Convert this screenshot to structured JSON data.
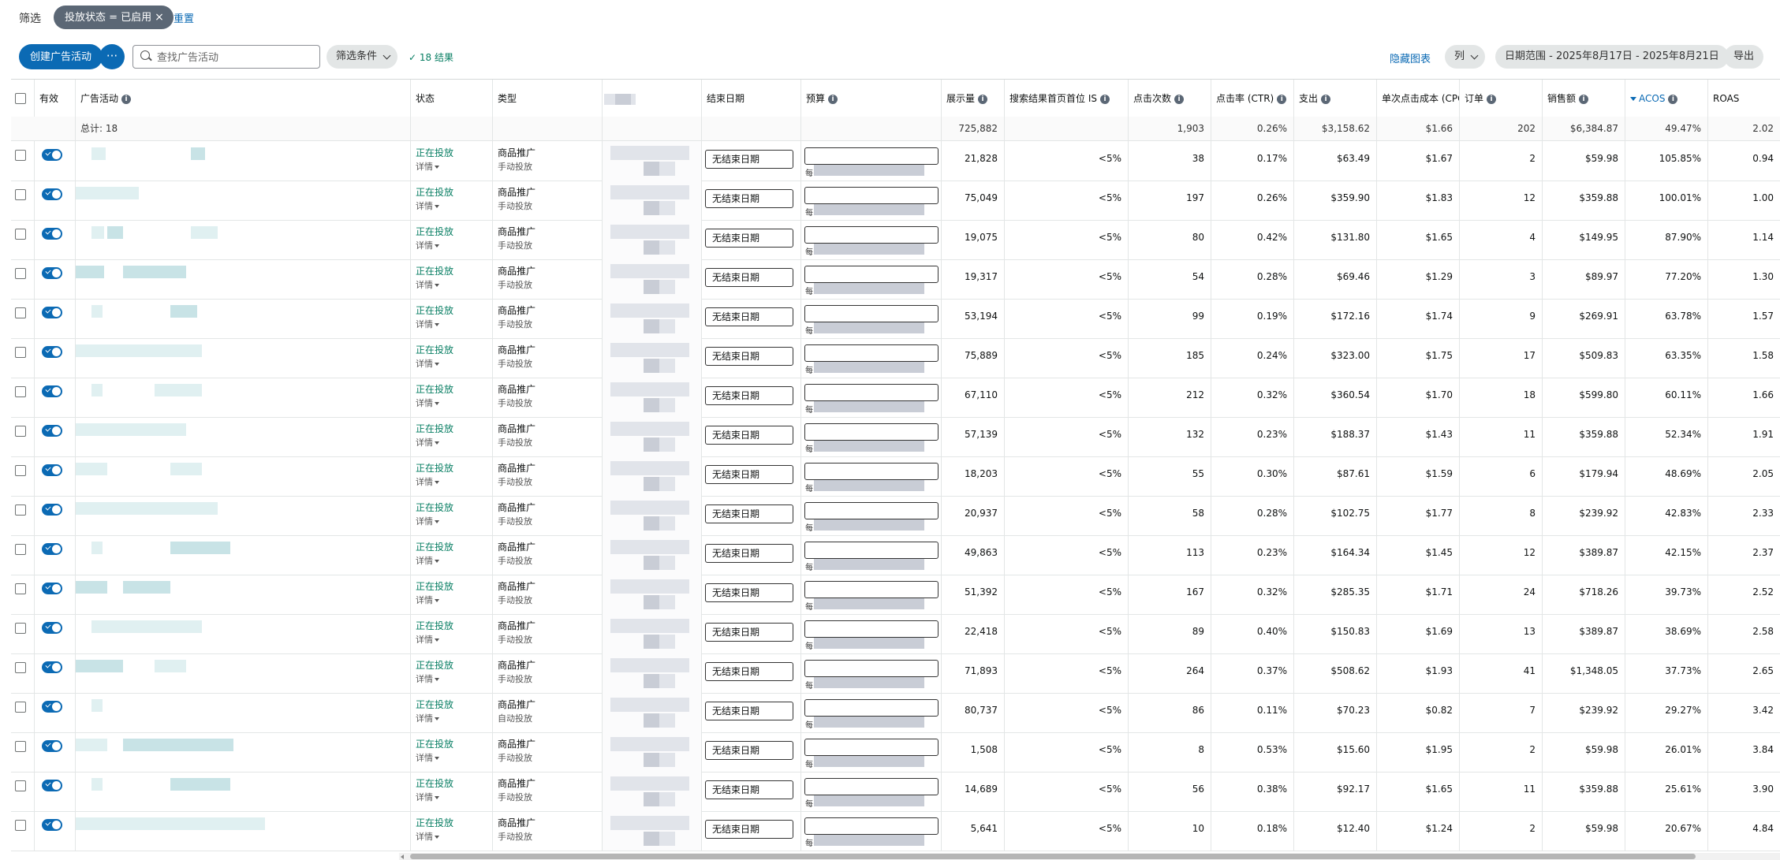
{
  "filter": {
    "label": "筛选",
    "chip_label": "投放状态 = 已启用",
    "chip_close": "×",
    "reset": "重置"
  },
  "toolbar": {
    "create": "创建广告活动",
    "more": "···",
    "search_placeholder": "查找广告活动",
    "filter_conditions": "筛选条件",
    "result_check": "✓",
    "result_count": "18 结果",
    "hide_chart": "隐藏图表",
    "columns": "列",
    "date_range": "日期范围 - 2025年8月17日 - 2025年8月21日",
    "export": "导出"
  },
  "columns": {
    "active": "有效",
    "campaign": "广告活动",
    "status": "状态",
    "type": "类型",
    "end_date": "结束日期",
    "budget": "预算",
    "impressions": "展示量",
    "top_is": "搜索结果首页首位 IS",
    "clicks": "点击次数",
    "ctr": "点击率 (CTR)",
    "spend": "支出",
    "cpc": "单次点击成本 (CPC)",
    "orders": "订单",
    "sales": "销售额",
    "acos": "ACOS",
    "roas": "ROAS",
    "info": "i"
  },
  "totals": {
    "label": "总计: 18",
    "impressions": "725,882",
    "clicks": "1,903",
    "ctr": "0.26%",
    "spend": "$3,158.62",
    "cpc": "$1.66",
    "orders": "202",
    "sales": "$6,384.87",
    "acos": "49.47%",
    "roas": "2.02"
  },
  "row_labels": {
    "status": "正在投放",
    "details": "详情",
    "type": "商品推广",
    "end_date": "无结束日期",
    "budget_prefix": "每"
  },
  "rows": [
    {
      "targeting": "手动投放",
      "impressions": "21,828",
      "top_is": "<5%",
      "clicks": "38",
      "ctr": "0.17%",
      "spend": "$63.49",
      "cpc": "$1.67",
      "orders": "2",
      "sales": "$59.98",
      "acos": "105.85%",
      "roas": "0.94"
    },
    {
      "targeting": "手动投放",
      "impressions": "75,049",
      "top_is": "<5%",
      "clicks": "197",
      "ctr": "0.26%",
      "spend": "$359.90",
      "cpc": "$1.83",
      "orders": "12",
      "sales": "$359.88",
      "acos": "100.01%",
      "roas": "1.00"
    },
    {
      "targeting": "手动投放",
      "impressions": "19,075",
      "top_is": "<5%",
      "clicks": "80",
      "ctr": "0.42%",
      "spend": "$131.80",
      "cpc": "$1.65",
      "orders": "4",
      "sales": "$149.95",
      "acos": "87.90%",
      "roas": "1.14"
    },
    {
      "targeting": "手动投放",
      "impressions": "19,317",
      "top_is": "<5%",
      "clicks": "54",
      "ctr": "0.28%",
      "spend": "$69.46",
      "cpc": "$1.29",
      "orders": "3",
      "sales": "$89.97",
      "acos": "77.20%",
      "roas": "1.30"
    },
    {
      "targeting": "手动投放",
      "impressions": "53,194",
      "top_is": "<5%",
      "clicks": "99",
      "ctr": "0.19%",
      "spend": "$172.16",
      "cpc": "$1.74",
      "orders": "9",
      "sales": "$269.91",
      "acos": "63.78%",
      "roas": "1.57"
    },
    {
      "targeting": "手动投放",
      "impressions": "75,889",
      "top_is": "<5%",
      "clicks": "185",
      "ctr": "0.24%",
      "spend": "$323.00",
      "cpc": "$1.75",
      "orders": "17",
      "sales": "$509.83",
      "acos": "63.35%",
      "roas": "1.58"
    },
    {
      "targeting": "手动投放",
      "impressions": "67,110",
      "top_is": "<5%",
      "clicks": "212",
      "ctr": "0.32%",
      "spend": "$360.54",
      "cpc": "$1.70",
      "orders": "18",
      "sales": "$599.80",
      "acos": "60.11%",
      "roas": "1.66"
    },
    {
      "targeting": "手动投放",
      "impressions": "57,139",
      "top_is": "<5%",
      "clicks": "132",
      "ctr": "0.23%",
      "spend": "$188.37",
      "cpc": "$1.43",
      "orders": "11",
      "sales": "$359.88",
      "acos": "52.34%",
      "roas": "1.91"
    },
    {
      "targeting": "手动投放",
      "impressions": "18,203",
      "top_is": "<5%",
      "clicks": "55",
      "ctr": "0.30%",
      "spend": "$87.61",
      "cpc": "$1.59",
      "orders": "6",
      "sales": "$179.94",
      "acos": "48.69%",
      "roas": "2.05"
    },
    {
      "targeting": "手动投放",
      "impressions": "20,937",
      "top_is": "<5%",
      "clicks": "58",
      "ctr": "0.28%",
      "spend": "$102.75",
      "cpc": "$1.77",
      "orders": "8",
      "sales": "$239.92",
      "acos": "42.83%",
      "roas": "2.33"
    },
    {
      "targeting": "手动投放",
      "impressions": "49,863",
      "top_is": "<5%",
      "clicks": "113",
      "ctr": "0.23%",
      "spend": "$164.34",
      "cpc": "$1.45",
      "orders": "12",
      "sales": "$389.87",
      "acos": "42.15%",
      "roas": "2.37"
    },
    {
      "targeting": "手动投放",
      "impressions": "51,392",
      "top_is": "<5%",
      "clicks": "167",
      "ctr": "0.32%",
      "spend": "$285.35",
      "cpc": "$1.71",
      "orders": "24",
      "sales": "$718.26",
      "acos": "39.73%",
      "roas": "2.52"
    },
    {
      "targeting": "手动投放",
      "impressions": "22,418",
      "top_is": "<5%",
      "clicks": "89",
      "ctr": "0.40%",
      "spend": "$150.83",
      "cpc": "$1.69",
      "orders": "13",
      "sales": "$389.87",
      "acos": "38.69%",
      "roas": "2.58"
    },
    {
      "targeting": "手动投放",
      "impressions": "71,893",
      "top_is": "<5%",
      "clicks": "264",
      "ctr": "0.37%",
      "spend": "$508.62",
      "cpc": "$1.93",
      "orders": "41",
      "sales": "$1,348.05",
      "acos": "37.73%",
      "roas": "2.65"
    },
    {
      "targeting": "自动投放",
      "impressions": "80,737",
      "top_is": "<5%",
      "clicks": "86",
      "ctr": "0.11%",
      "spend": "$70.23",
      "cpc": "$0.82",
      "orders": "7",
      "sales": "$239.92",
      "acos": "29.27%",
      "roas": "3.42"
    },
    {
      "targeting": "手动投放",
      "impressions": "1,508",
      "top_is": "<5%",
      "clicks": "8",
      "ctr": "0.53%",
      "spend": "$15.60",
      "cpc": "$1.95",
      "orders": "2",
      "sales": "$59.98",
      "acos": "26.01%",
      "roas": "3.84"
    },
    {
      "targeting": "手动投放",
      "impressions": "14,689",
      "top_is": "<5%",
      "clicks": "56",
      "ctr": "0.38%",
      "spend": "$92.17",
      "cpc": "$1.65",
      "orders": "11",
      "sales": "$359.88",
      "acos": "25.61%",
      "roas": "3.90"
    },
    {
      "targeting": "手动投放",
      "impressions": "5,641",
      "top_is": "<5%",
      "clicks": "10",
      "ctr": "0.18%",
      "spend": "$12.40",
      "cpc": "$1.24",
      "orders": "2",
      "sales": "$59.98",
      "acos": "20.67%",
      "roas": "4.84"
    }
  ],
  "colors": {
    "primary": "#0b6ab4",
    "status_green": "#067d62",
    "chip_bg": "#5b6775"
  }
}
